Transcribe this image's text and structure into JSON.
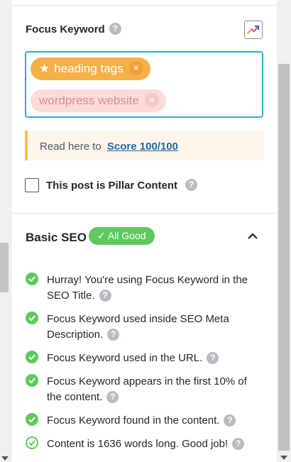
{
  "focus_keyword": {
    "title": "Focus Keyword",
    "help_icon": "question-circle-icon",
    "trend_icon": "trending-chart-icon",
    "tags": [
      {
        "label": "heading tags",
        "primary": true
      },
      {
        "label": "wordpress website",
        "primary": false
      }
    ],
    "tag_remove_glyph": "×",
    "star_glyph": "★"
  },
  "notice": {
    "prefix": "Read here to",
    "link_text": "Score 100/100"
  },
  "pillar": {
    "label": "This post is Pillar Content",
    "checked": false
  },
  "basic_seo": {
    "title": "Basic SEO",
    "badge": "✓ All Good",
    "collapse_glyph": "^",
    "checks": [
      {
        "text": "Hurray! You're using Focus Keyword in the SEO Title.",
        "status": "pass"
      },
      {
        "text": "Focus Keyword used inside SEO Meta Description.",
        "status": "pass"
      },
      {
        "text": "Focus Keyword used in the URL.",
        "status": "pass"
      },
      {
        "text": "Focus Keyword appears in the first 10% of the content.",
        "status": "pass"
      },
      {
        "text": "Focus Keyword found in the content.",
        "status": "pass"
      },
      {
        "text": "Content is 1636 words long. Good job!",
        "status": "pass-outline"
      }
    ]
  },
  "help_glyph": "?",
  "colors": {
    "accent_border": "#2ab0cc",
    "primary_tag": "#f6b048",
    "secondary_tag": "#fbdada",
    "good": "#5fc95f",
    "link": "#1e6ba8",
    "notice_bar": "#f2c14e"
  }
}
